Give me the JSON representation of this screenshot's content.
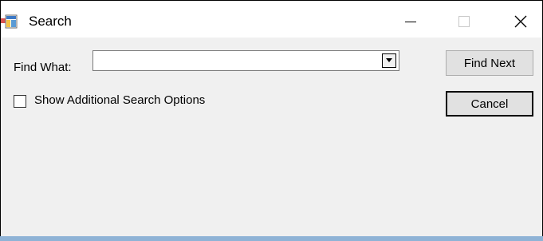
{
  "window": {
    "title": "Search"
  },
  "titlebar_buttons": {
    "minimize": "minimize-icon",
    "maximize": "maximize-icon",
    "close": "close-icon"
  },
  "form": {
    "find_label": "Find What:",
    "find_value": "",
    "checkbox_label": "Show Additional Search Options",
    "checkbox_checked": false
  },
  "buttons": {
    "find_next": "Find Next",
    "cancel": "Cancel"
  },
  "colors": {
    "dialog_background": "#f0f0f0",
    "titlebar_background": "#ffffff",
    "button_face": "#e1e1e1",
    "taskbar_strip": "#8fb3d6"
  }
}
